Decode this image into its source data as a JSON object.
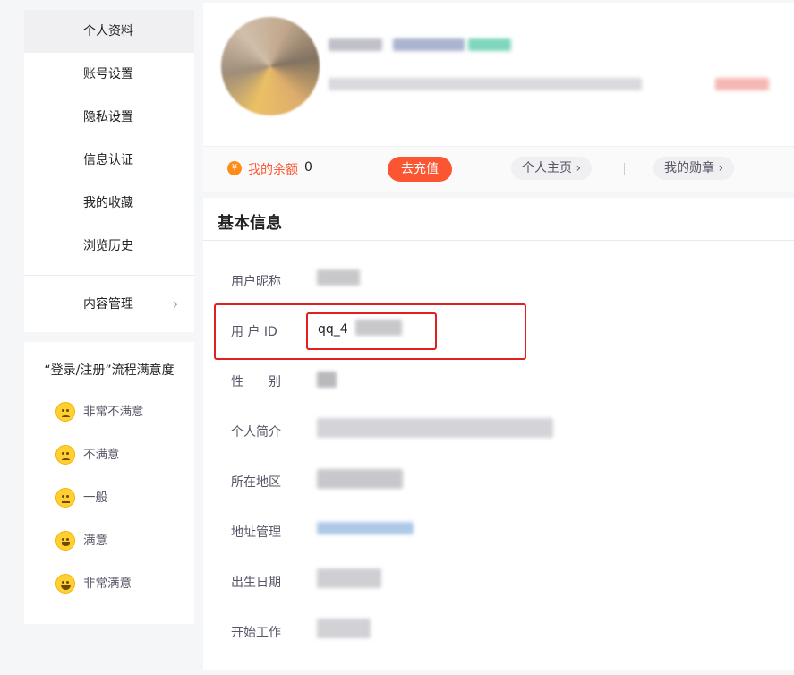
{
  "sidebar": {
    "items": [
      {
        "label": "个人资料",
        "active": true
      },
      {
        "label": "账号设置"
      },
      {
        "label": "隐私设置"
      },
      {
        "label": "信息认证"
      },
      {
        "label": "我的收藏"
      },
      {
        "label": "浏览历史"
      }
    ],
    "manage_label": "内容管理",
    "manage_chevron": "›"
  },
  "survey": {
    "title": "“登录/注册”流程满意度",
    "options": [
      {
        "label": "非常不满意",
        "icon": "angry-face-icon"
      },
      {
        "label": "不满意",
        "icon": "unhappy-face-icon"
      },
      {
        "label": "一般",
        "icon": "neutral-face-icon"
      },
      {
        "label": "满意",
        "icon": "smile-face-icon"
      },
      {
        "label": "非常满意",
        "icon": "grin-face-icon"
      }
    ]
  },
  "stats": {
    "yen_symbol": "¥",
    "balance_label": "我的余额",
    "balance_value": "0",
    "recharge_label": "去充值",
    "homepage_label": "个人主页 ›",
    "medals_label": "我的勋章 ›"
  },
  "basic_info": {
    "title": "基本信息",
    "rows": [
      {
        "label": "用户昵称"
      },
      {
        "label": "用 户  ID",
        "value": "qq_4"
      },
      {
        "label": "性　　别"
      },
      {
        "label": "个人简介"
      },
      {
        "label": "所在地区"
      },
      {
        "label": "地址管理"
      },
      {
        "label": "出生日期"
      },
      {
        "label": "开始工作"
      }
    ]
  },
  "colors": {
    "accent": "#fc5531",
    "highlight_box": "#e02020",
    "page_bg": "#f5f6f7"
  }
}
